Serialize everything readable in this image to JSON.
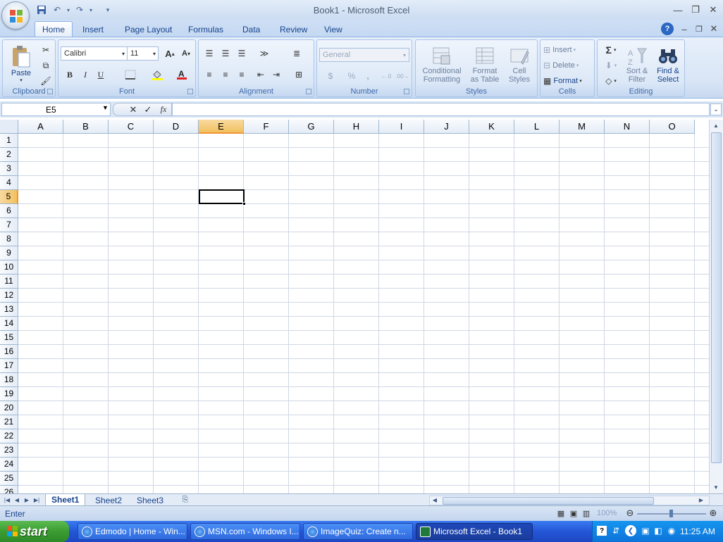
{
  "window": {
    "title": "Book1 - Microsoft Excel"
  },
  "tabs": [
    "Home",
    "Insert",
    "Page Layout",
    "Formulas",
    "Data",
    "Review",
    "View"
  ],
  "ribbon": {
    "clipboard": {
      "label": "Clipboard",
      "paste": "Paste"
    },
    "font": {
      "label": "Font",
      "name": "Calibri",
      "size": "11",
      "bold": "B",
      "italic": "I",
      "underline": "U"
    },
    "alignment": {
      "label": "Alignment"
    },
    "number": {
      "label": "Number",
      "format": "General",
      "currency": "$",
      "percent": "%",
      "comma": ","
    },
    "styles": {
      "label": "Styles",
      "conditional_1": "Conditional",
      "conditional_2": "Formatting",
      "table_1": "Format",
      "table_2": "as Table",
      "cell_1": "Cell",
      "cell_2": "Styles"
    },
    "cells": {
      "label": "Cells",
      "insert": "Insert",
      "delete": "Delete",
      "format": "Format"
    },
    "editing": {
      "label": "Editing",
      "sigma": "Σ",
      "sort_1": "Sort &",
      "sort_2": "Filter",
      "find_1": "Find &",
      "find_2": "Select"
    }
  },
  "formula_bar": {
    "name_box": "E5",
    "fx": "fx",
    "value": ""
  },
  "grid": {
    "columns": [
      "A",
      "B",
      "C",
      "D",
      "E",
      "F",
      "G",
      "H",
      "I",
      "J",
      "K",
      "L",
      "M",
      "N",
      "O"
    ],
    "rows": [
      "1",
      "2",
      "3",
      "4",
      "5",
      "6",
      "7",
      "8",
      "9",
      "10",
      "11",
      "12",
      "13",
      "14",
      "15",
      "16",
      "17",
      "18",
      "19",
      "20",
      "21",
      "22",
      "23",
      "24",
      "25",
      "26"
    ],
    "active_column": "E",
    "active_row": "5"
  },
  "sheets": [
    "Sheet1",
    "Sheet2",
    "Sheet3"
  ],
  "active_sheet": "Sheet1",
  "status": {
    "mode": "Enter",
    "zoom": "100%"
  },
  "taskbar": {
    "start": "start",
    "tasks": [
      {
        "label": "Edmodo | Home - Win..."
      },
      {
        "label": "MSN.com - Windows I..."
      },
      {
        "label": "ImageQuiz: Create n..."
      },
      {
        "label": "Microsoft Excel - Book1"
      }
    ],
    "clock": "11:25 AM"
  },
  "colors": {
    "accent": "#15428b",
    "selected_header": "#f1c15f",
    "taskbar": "#2456d6",
    "start": "#3b9c32"
  }
}
